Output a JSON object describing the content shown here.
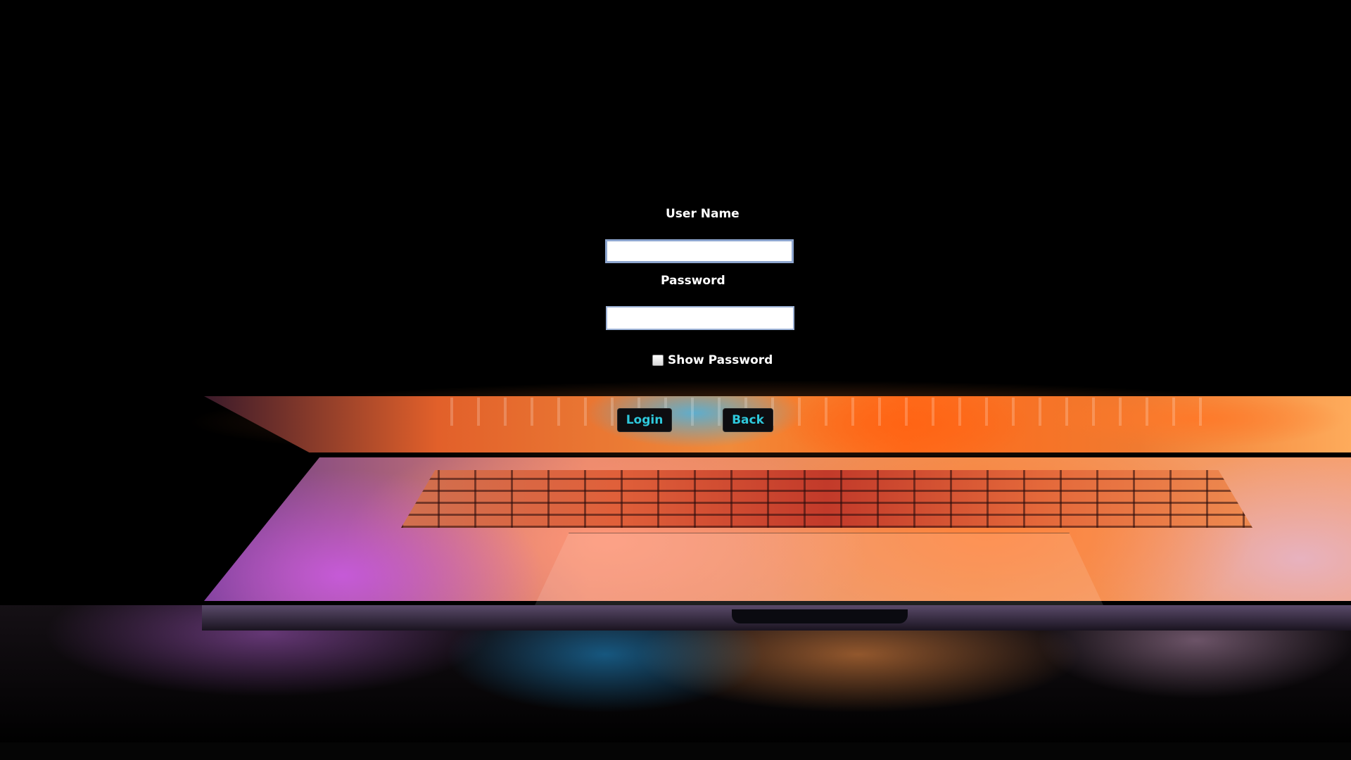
{
  "login_form": {
    "username_label": "User Name",
    "username_value": "",
    "password_label": "Password",
    "password_value": "",
    "show_password_label": "Show Password",
    "show_password_checked": false,
    "login_button": "Login",
    "back_button": "Back"
  },
  "colors": {
    "background": "#000000",
    "label_text": "#ffffff",
    "button_text": "#2ec9dc",
    "button_bg": "#0d0d10"
  }
}
